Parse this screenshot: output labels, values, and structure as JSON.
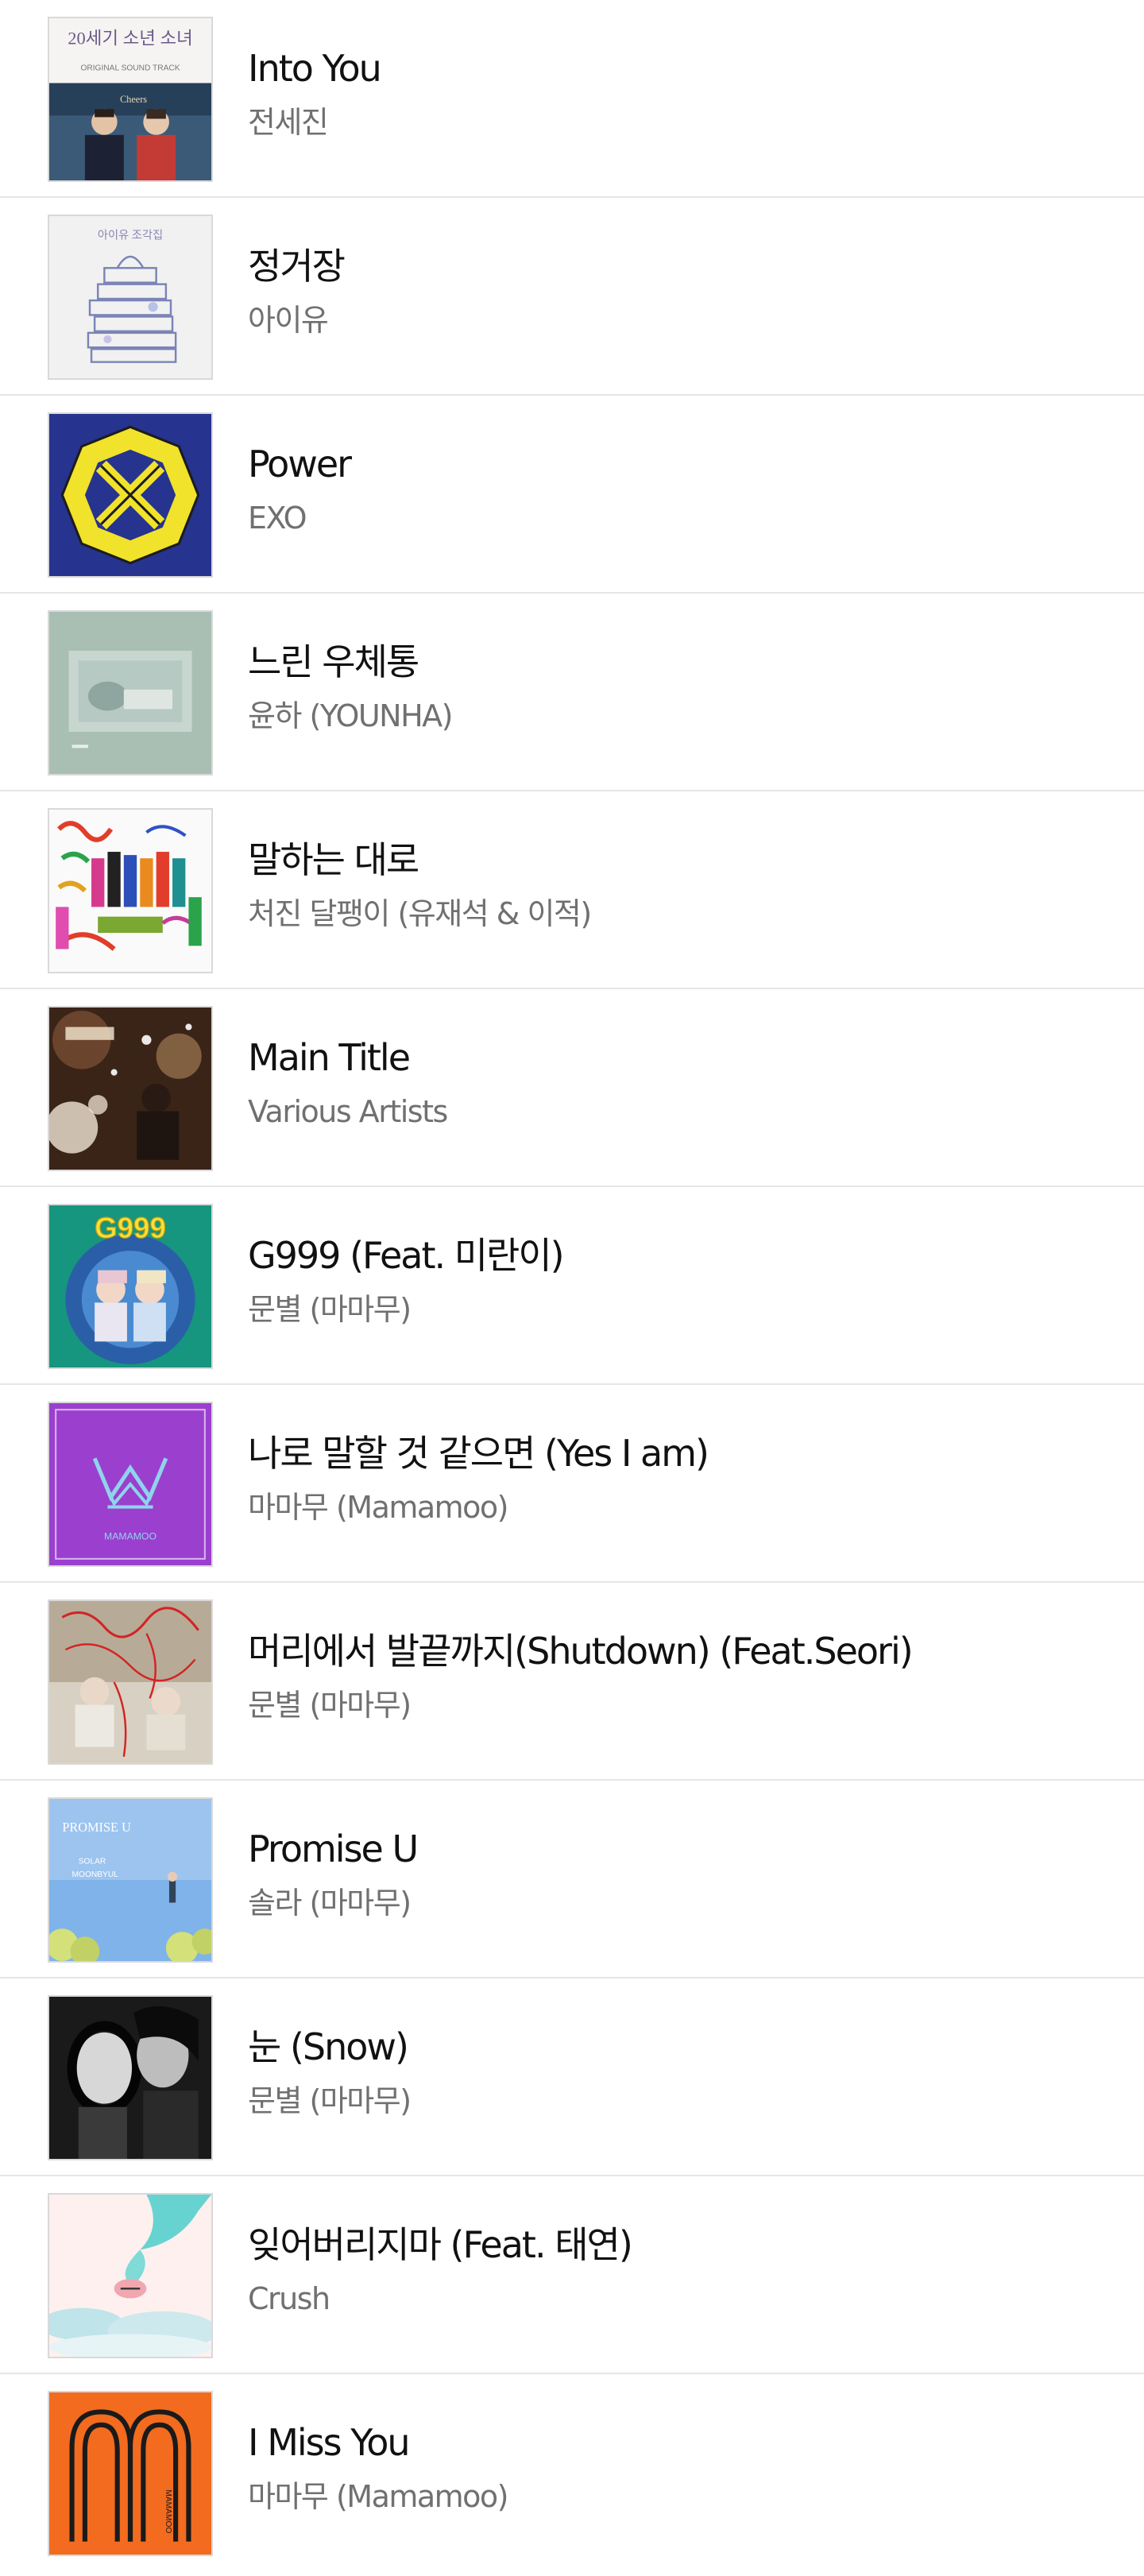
{
  "tracks": [
    {
      "title": "Into You",
      "artist": "전세진",
      "cover_icon": "drama-ost-cover-icon",
      "cover_texts": [
        "20세기 소년 소녀",
        "ORIGINAL SOUND TRACK",
        "Cheers"
      ]
    },
    {
      "title": "정거장",
      "artist": "아이유",
      "cover_icon": "stacked-books-cover-icon",
      "cover_texts": [
        "아이유 조각집"
      ]
    },
    {
      "title": "Power",
      "artist": "EXO",
      "cover_icon": "exo-emblem-cover-icon",
      "cover_texts": []
    },
    {
      "title": "느린 우체통",
      "artist": "윤하 (YOUNHA)",
      "cover_icon": "pastel-portrait-cover-icon",
      "cover_texts": []
    },
    {
      "title": "말하는 대로",
      "artist": "처진 달팽이 (유재석 & 이적)",
      "cover_icon": "colorful-group-cover-icon",
      "cover_texts": []
    },
    {
      "title": "Main Title",
      "artist": "Various Artists",
      "cover_icon": "sparkle-portrait-cover-icon",
      "cover_texts": []
    },
    {
      "title": "G999 (Feat. 미란이)",
      "artist": "문별 (마마무)",
      "cover_icon": "g999-cover-icon",
      "cover_texts": [
        "G999"
      ]
    },
    {
      "title": "나로 말할 것 같으면 (Yes I am)",
      "artist": "마마무 (Mamamoo)",
      "cover_icon": "crown-cover-icon",
      "cover_texts": [
        "MAMAMOO"
      ]
    },
    {
      "title": "머리에서 발끝까지(Shutdown) (Feat.Seori)",
      "artist": "문별 (마마무)",
      "cover_icon": "red-scribble-cover-icon",
      "cover_texts": []
    },
    {
      "title": "Promise U",
      "artist": "솔라 (마마무)",
      "cover_icon": "sky-flowers-cover-icon",
      "cover_texts": [
        "PROMISE U",
        "SOLAR",
        "MOONBYUL"
      ]
    },
    {
      "title": "눈 (Snow)",
      "artist": "문별 (마마무)",
      "cover_icon": "monochrome-portrait-cover-icon",
      "cover_texts": []
    },
    {
      "title": "잊어버리지마 (Feat. 태연)",
      "artist": "Crush",
      "cover_icon": "clouds-cover-icon",
      "cover_texts": []
    },
    {
      "title": "I Miss You",
      "artist": "마마무 (Mamamoo)",
      "cover_icon": "orange-m-cover-icon",
      "cover_texts": [
        "MAMAMOO"
      ]
    }
  ],
  "colors": {
    "title": "#111111",
    "artist": "#707070",
    "divider": "#e6e6e6"
  }
}
